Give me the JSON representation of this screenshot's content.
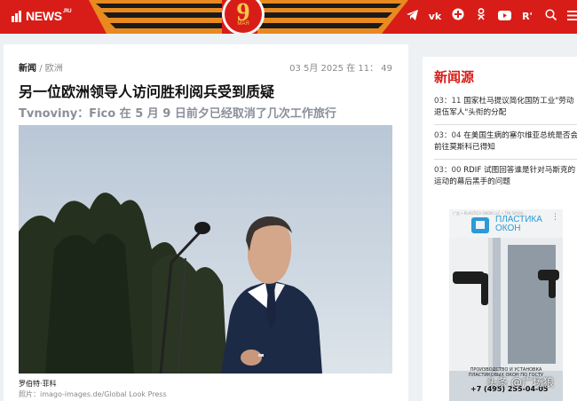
{
  "header": {
    "logo_text": "NEWS",
    "logo_suffix": ".RU",
    "badge_number": "9",
    "badge_month": "МАЯ",
    "social_icons": [
      "telegram-icon",
      "vk-icon",
      "ok-plus-icon",
      "odnoklassniki-icon",
      "youtube-icon",
      "rutube-icon",
      "search-icon",
      "menu-icon"
    ],
    "colors": {
      "header_bg": "#d81d18",
      "accent_gold": "#f6c74a"
    }
  },
  "article": {
    "category": "新闻",
    "separator": "/",
    "subcategory": "欧洲",
    "date": "03 5月 2025 在 11： 49",
    "title": "另一位欧洲领导人访问胜利阅兵受到质疑",
    "subtitle": "Tvnoviny：Fico 在 5 月 9 日前夕已经取消了几次工作旅行",
    "photo_caption": "罗伯特·菲科",
    "photo_credit": "照片：imago-images.de/Global Look Press"
  },
  "sidebar": {
    "title": "新闻源",
    "items": [
      {
        "time": "03：11",
        "text": "国家杜马提议简化国防工业\"劳动退伍军人\"头衔的分配"
      },
      {
        "time": "03：04",
        "text": "在美国生病的塞尔维亚总统是否会前往莫斯科已得知"
      },
      {
        "time": "03：00",
        "text": "RDIF 试图回答谁是针对马斯克的运动的幕后黑手的问题"
      }
    ]
  },
  "ad": {
    "small_text": "广告 • PLASTICA OKON LLC • TIN 50500...",
    "brand_line1": "ПЛАСТИКА",
    "brand_line2": "ОКОН",
    "text_line1": "ПРОИЗВОДСТВО И УСТАНОВКА",
    "text_line2": "ПЛАСТИКОВЫХ ОКОН ПО ГОСТУ",
    "phone": "+7 (495) 255-04-05"
  },
  "watermark": "头条 @广场狼"
}
